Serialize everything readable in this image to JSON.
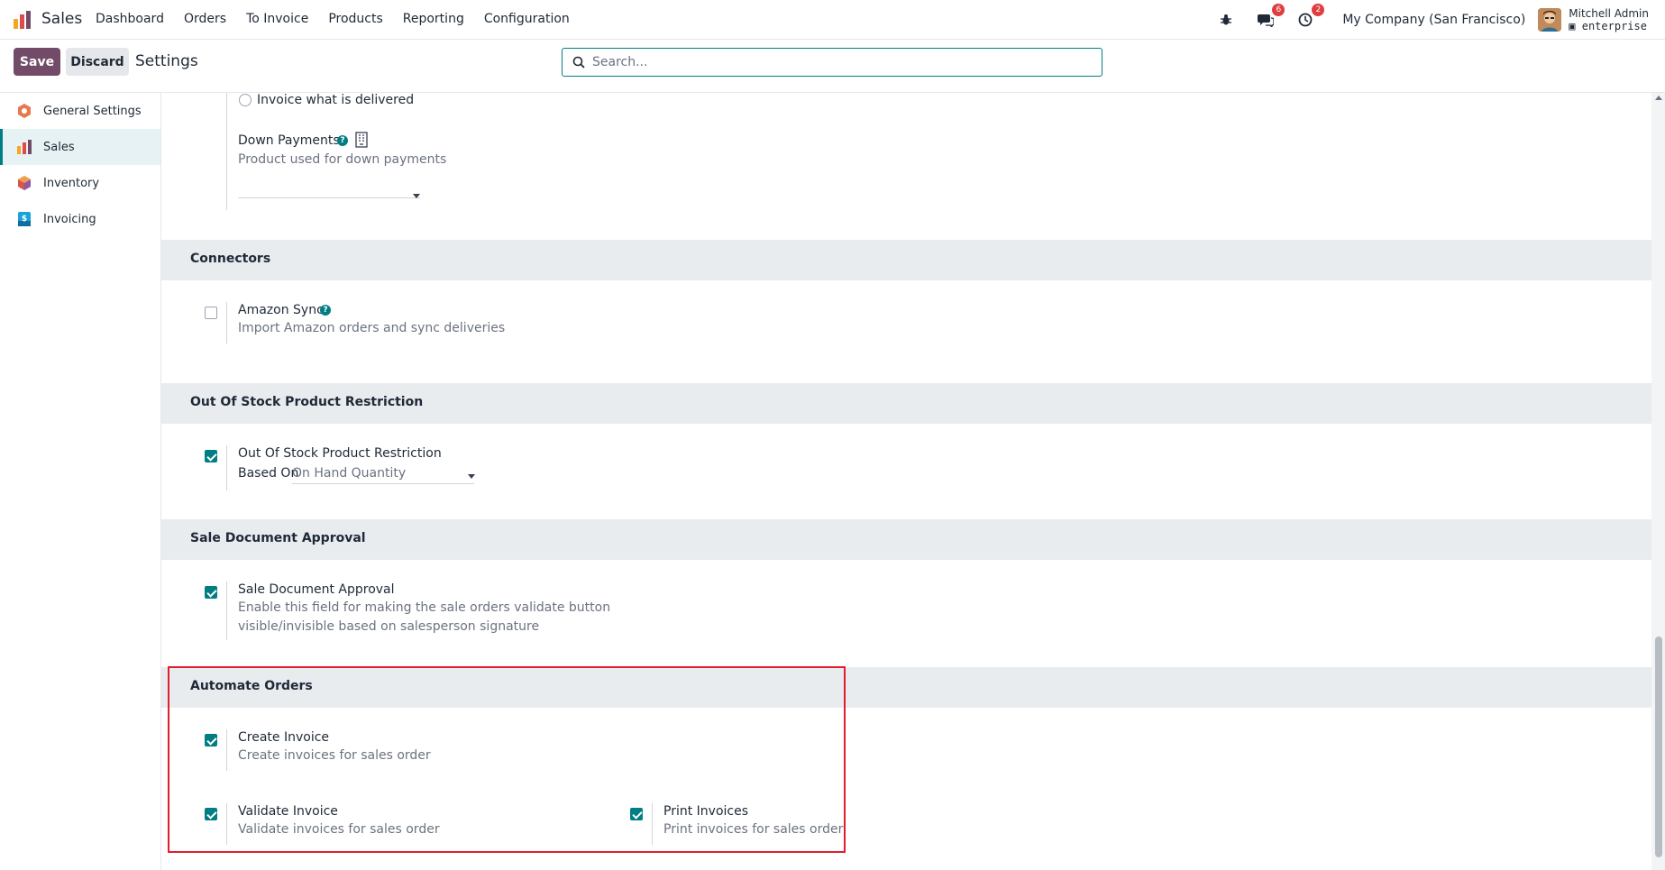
{
  "navbar": {
    "app_name": "Sales",
    "menu": [
      "Dashboard",
      "Orders",
      "To Invoice",
      "Products",
      "Reporting",
      "Configuration"
    ],
    "messages_count": "6",
    "activities_count": "2",
    "company": "My Company (San Francisco)",
    "user_name": "Mitchell Admin",
    "user_db": "enterprise"
  },
  "control": {
    "save_label": "Save",
    "discard_label": "Discard",
    "title": "Settings",
    "search_placeholder": "Search..."
  },
  "sidebar": {
    "items": [
      {
        "label": "General Settings",
        "icon": "general-settings-icon"
      },
      {
        "label": "Sales",
        "icon": "sales-icon",
        "active": true
      },
      {
        "label": "Inventory",
        "icon": "inventory-icon"
      },
      {
        "label": "Invoicing",
        "icon": "invoicing-icon"
      }
    ]
  },
  "settings": {
    "invoice_delivered_label": "Invoice what is delivered",
    "down_payments": {
      "label": "Down Payments",
      "desc": "Product used for down payments"
    },
    "connectors": {
      "title": "Connectors",
      "amazon": {
        "label": "Amazon Sync",
        "desc": "Import Amazon orders and sync deliveries",
        "checked": false
      }
    },
    "out_of_stock": {
      "title": "Out Of Stock Product Restriction",
      "label": "Out Of Stock Product Restriction",
      "based_on_label": "Based On",
      "based_on_value": "On Hand Quantity",
      "checked": true
    },
    "approval": {
      "title": "Sale Document Approval",
      "label": "Sale Document Approval",
      "desc_line1": "Enable this field for making the sale orders validate button",
      "desc_line2": "visible/invisible based on salesperson signature",
      "checked": true
    },
    "automate": {
      "title": "Automate Orders",
      "create": {
        "label": "Create Invoice",
        "desc": "Create invoices for sales order",
        "checked": true
      },
      "validate": {
        "label": "Validate Invoice",
        "desc": "Validate invoices for sales order",
        "checked": true
      },
      "print": {
        "label": "Print Invoices",
        "desc": "Print invoices for sales order",
        "checked": true
      }
    }
  },
  "colors": {
    "brand": "#714b67",
    "accent": "#017e84",
    "highlight": "#e11d2e"
  }
}
